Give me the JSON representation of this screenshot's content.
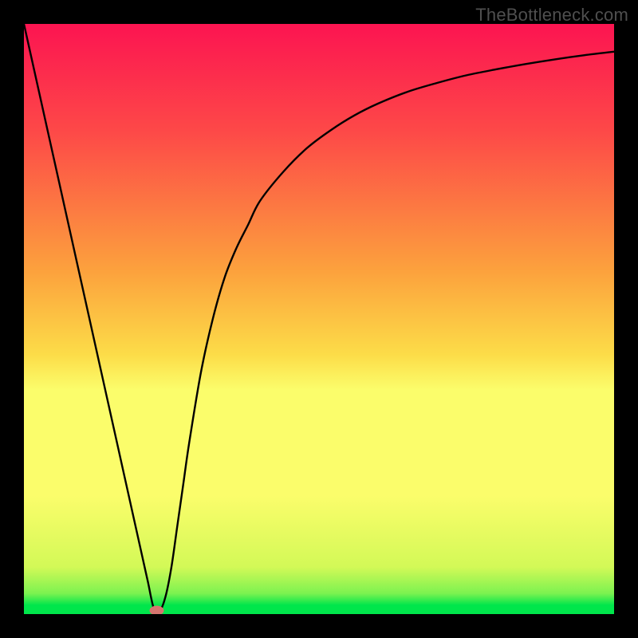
{
  "watermark": "TheBottleneck.com",
  "chart_data": {
    "type": "line",
    "title": "",
    "xlabel": "",
    "ylabel": "",
    "xlim": [
      0,
      100
    ],
    "ylim": [
      0,
      100
    ],
    "grid": false,
    "legend": false,
    "series": [
      {
        "name": "bottleneck-curve",
        "x": [
          0,
          2,
          4,
          6,
          8,
          10,
          12,
          14,
          16,
          18,
          20,
          21,
          22,
          23,
          24,
          25,
          26,
          27,
          28,
          30,
          32,
          34,
          36,
          38,
          40,
          44,
          48,
          52,
          56,
          60,
          65,
          70,
          75,
          80,
          85,
          90,
          95,
          100
        ],
        "y": [
          100,
          91,
          82,
          73,
          64,
          55,
          46,
          37,
          28,
          19,
          10,
          5.5,
          1,
          0.5,
          3,
          8,
          15,
          22,
          29,
          41,
          50,
          57,
          62,
          66,
          70,
          75,
          79,
          82,
          84.5,
          86.5,
          88.5,
          90,
          91.3,
          92.3,
          93.2,
          94,
          94.7,
          95.3
        ]
      }
    ],
    "annotations": [
      {
        "name": "marker-pink",
        "x": 22.5,
        "y": 0.6,
        "color": "#d6756f"
      }
    ],
    "bands": [
      {
        "name": "yellow-mid-band",
        "y0": 35,
        "y1": 44,
        "color": "#fbfd6b"
      },
      {
        "name": "green-bottom-band",
        "y0": 0,
        "y1": 3,
        "color": "#00e64b"
      }
    ],
    "background_gradient_stops": [
      {
        "offset": 0,
        "color": "#fc1451"
      },
      {
        "offset": 18,
        "color": "#fd4848"
      },
      {
        "offset": 42,
        "color": "#fca23d"
      },
      {
        "offset": 56,
        "color": "#fcdc48"
      },
      {
        "offset": 62,
        "color": "#fbfd6b"
      },
      {
        "offset": 80,
        "color": "#fbfd6b"
      },
      {
        "offset": 92,
        "color": "#d3f957"
      },
      {
        "offset": 96.5,
        "color": "#7cf250"
      },
      {
        "offset": 98.5,
        "color": "#00e64b"
      },
      {
        "offset": 100,
        "color": "#00e64b"
      }
    ]
  }
}
